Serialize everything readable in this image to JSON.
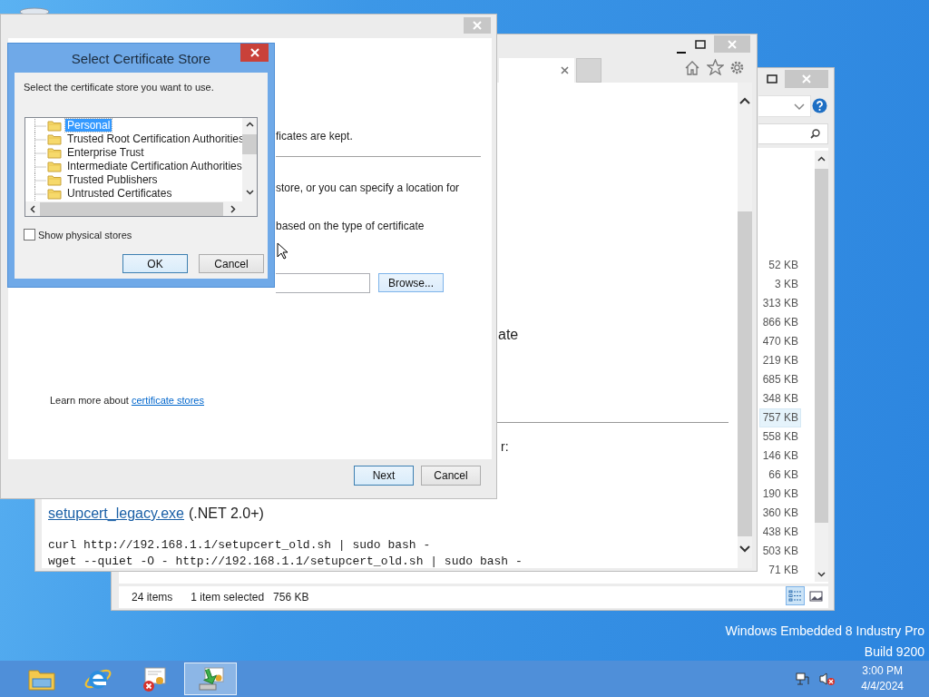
{
  "desktop": {
    "watermark": [
      "Windows Embedded 8 Industry Pro",
      "Build 9200"
    ]
  },
  "explorer": {
    "sizes": [
      {
        "size": "52 KB",
        "selected": false
      },
      {
        "size": "3 KB",
        "selected": false
      },
      {
        "size": "313 KB",
        "selected": false
      },
      {
        "size": "866 KB",
        "selected": false
      },
      {
        "size": "470 KB",
        "selected": false
      },
      {
        "size": "219 KB",
        "selected": false
      },
      {
        "size": "685 KB",
        "selected": false
      },
      {
        "size": "348 KB",
        "selected": false
      },
      {
        "size": "757 KB",
        "selected": true
      },
      {
        "size": "558 KB",
        "selected": false
      },
      {
        "size": "146 KB",
        "selected": false
      },
      {
        "size": "66 KB",
        "selected": false
      },
      {
        "size": "190 KB",
        "selected": false
      },
      {
        "size": "360 KB",
        "selected": false
      },
      {
        "size": "438 KB",
        "selected": false
      },
      {
        "size": "503 KB",
        "selected": false
      },
      {
        "size": "71 KB",
        "selected": false
      }
    ],
    "status": {
      "items": "24 items",
      "selection": "1 item selected",
      "selection_size": "756 KB"
    },
    "views": [
      {
        "kind": "details",
        "selected": true
      },
      {
        "kind": "preview",
        "selected": false
      }
    ]
  },
  "browser": {
    "heading_fragment": "ate",
    "label_fragment": "r:",
    "download": {
      "link": "setupcert_legacy.exe",
      "note": "(.NET 2.0+)"
    },
    "commands": [
      "curl http://192.168.1.1/setupcert_old.sh | sudo bash -",
      "wget --quiet -O - http://192.168.1.1/setupcert_old.sh | sudo bash -"
    ]
  },
  "wizard": {
    "text_fragments": [
      "ficates are kept.",
      "store, or you can specify a location for",
      "based on the type of certificate"
    ],
    "browse_button": "Browse...",
    "learn_more": {
      "text": "Learn more about",
      "link": "certificate stores"
    },
    "buttons": [
      {
        "label": "Next",
        "default": true
      },
      {
        "label": "Cancel",
        "default": false
      }
    ]
  },
  "dialog": {
    "title": "Select Certificate Store",
    "prompt": "Select the certificate store you want to use.",
    "stores": [
      {
        "label": "Personal",
        "selected": true
      },
      {
        "label": "Trusted Root Certification Authorities",
        "selected": false
      },
      {
        "label": "Enterprise Trust",
        "selected": false
      },
      {
        "label": "Intermediate Certification Authorities",
        "selected": false
      },
      {
        "label": "Trusted Publishers",
        "selected": false
      },
      {
        "label": "Untrusted Certificates",
        "selected": false
      }
    ],
    "show_physical_stores": {
      "label": "Show physical stores",
      "checked": false
    },
    "buttons": [
      {
        "label": "OK",
        "default": true
      },
      {
        "label": "Cancel",
        "default": false
      }
    ]
  },
  "taskbar": {
    "apps": [
      {
        "kind": "explorer",
        "selected": false
      },
      {
        "kind": "browser",
        "selected": false
      },
      {
        "kind": "certificate-error",
        "selected": false
      },
      {
        "kind": "certificate-import",
        "selected": true
      }
    ],
    "clock": {
      "time": "3:00 PM",
      "date": "4/4/2024"
    }
  }
}
